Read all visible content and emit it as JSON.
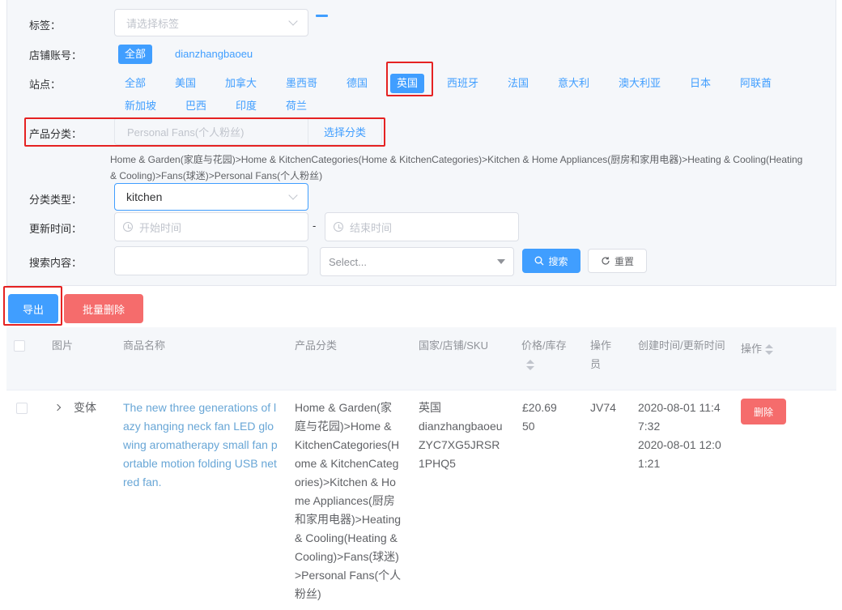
{
  "filters": {
    "tag_label": "标签：",
    "tag_placeholder": "请选择标签",
    "store_label": "店铺账号：",
    "store_options": [
      "全部",
      "dianzhangbaoeu"
    ],
    "site_label": "站点：",
    "sites": [
      "全部",
      "美国",
      "加拿大",
      "墨西哥",
      "德国",
      "英国",
      "西班牙",
      "法国",
      "意大利",
      "澳大利亚",
      "日本",
      "阿联酋",
      "新加坡",
      "巴西",
      "印度",
      "荷兰"
    ],
    "site_selected": "英国",
    "category_label": "产品分类：",
    "category_value": "Personal Fans(个人粉丝)",
    "category_button": "选择分类",
    "category_path": "Home & Garden(家庭与花园)>Home & KitchenCategories(Home & KitchenCategories)>Kitchen & Home Appliances(厨房和家用电器)>Heating & Cooling(Heating & Cooling)>Fans(球迷)>Personal Fans(个人粉丝)",
    "type_label": "分类类型：",
    "type_value": "kitchen",
    "time_label": "更新时间：",
    "time_start_placeholder": "开始时间",
    "time_separator": "-",
    "time_end_placeholder": "结束时间",
    "search_label": "搜索内容：",
    "search_select_placeholder": "Select...",
    "search_button": "搜索",
    "reset_button": "重置"
  },
  "actions": {
    "export": "导出",
    "batch_delete": "批量删除"
  },
  "table": {
    "headers": {
      "image": "图片",
      "name": "商品名称",
      "category": "产品分类",
      "country_sku": "国家/店铺/SKU",
      "price_stock": "价格/库存",
      "operator": "操作员",
      "time": "创建时间/更新时间",
      "action": "操作"
    },
    "rows": [
      {
        "variant": "变体",
        "name": "The new three generations of lazy hanging neck fan LED glowing aromatherapy small fan portable motion folding USB net red fan.",
        "category": "Home & Garden(家庭与花园)>Home & KitchenCategories(Home & KitchenCategories)>Kitchen & Home Appliances(厨房和家用电器)>Heating & Cooling(Heating & Cooling)>Fans(球迷)>Personal Fans(个人粉丝)",
        "country": "英国",
        "store": "dianzhangbaoeu",
        "sku": "ZYC7XG5JRSR1PHQ5",
        "price": "£20.69",
        "stock": "50",
        "operator": "JV74",
        "created": "2020-08-01 11:47:32",
        "updated": "2020-08-01 12:01:21",
        "delete": "删除"
      }
    ]
  },
  "colors": {
    "primary": "#409eff",
    "danger": "#f56c6c",
    "highlight_box": "#e52222"
  }
}
